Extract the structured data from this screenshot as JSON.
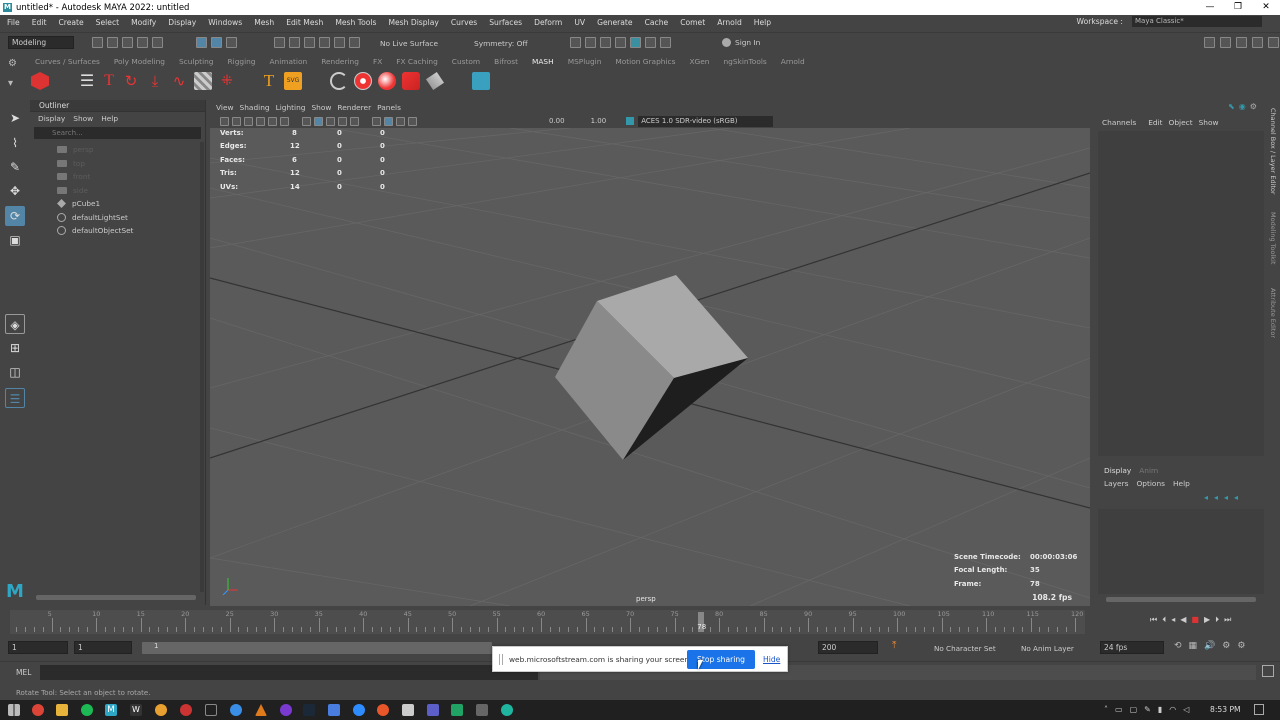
{
  "window": {
    "title": "untitled* - Autodesk MAYA 2022: untitled",
    "minimize": "—",
    "maximize": "❐",
    "close": "✕"
  },
  "menubar": {
    "items": [
      "File",
      "Edit",
      "Create",
      "Select",
      "Modify",
      "Display",
      "Windows",
      "Mesh",
      "Edit Mesh",
      "Mesh Tools",
      "Mesh Display",
      "Curves",
      "Surfaces",
      "Deform",
      "UV",
      "Generate",
      "Cache",
      "Comet",
      "Arnold",
      "Help"
    ]
  },
  "workspace": {
    "label": "Workspace :",
    "value": "Maya Classic*"
  },
  "statusline": {
    "mode": "Modeling",
    "live_surface": "No Live Surface",
    "symmetry": "Symmetry: Off",
    "sign_in": "Sign In"
  },
  "shelf": {
    "tabs": [
      "Curves / Surfaces",
      "Poly Modeling",
      "Sculpting",
      "Rigging",
      "Animation",
      "Rendering",
      "FX",
      "FX Caching",
      "Custom",
      "Bifrost",
      "MASH",
      "MSPlugin",
      "Motion Graphics",
      "XGen",
      "ngSkinTools",
      "Arnold"
    ],
    "active": "MASH"
  },
  "outliner": {
    "title": "Outliner",
    "menu": [
      "Display",
      "Show",
      "Help"
    ],
    "search_placeholder": "Search...",
    "items": [
      {
        "label": "persp",
        "dim": true
      },
      {
        "label": "top",
        "dim": true
      },
      {
        "label": "front",
        "dim": true
      },
      {
        "label": "side",
        "dim": true
      },
      {
        "label": "pCube1",
        "dim": false
      },
      {
        "label": "defaultLightSet",
        "dim": false
      },
      {
        "label": "defaultObjectSet",
        "dim": false
      }
    ]
  },
  "viewport": {
    "menu": [
      "View",
      "Shading",
      "Lighting",
      "Show",
      "Renderer",
      "Panels"
    ],
    "exposure": "0.00",
    "gamma": "1.00",
    "colorspace": "ACES 1.0 SDR-video (sRGB)",
    "camera": "persp",
    "stats": [
      {
        "label": "Verts:",
        "v1": "8",
        "v2": "0",
        "v3": "0"
      },
      {
        "label": "Edges:",
        "v1": "12",
        "v2": "0",
        "v3": "0"
      },
      {
        "label": "Faces:",
        "v1": "6",
        "v2": "0",
        "v3": "0"
      },
      {
        "label": "Tris:",
        "v1": "12",
        "v2": "0",
        "v3": "0"
      },
      {
        "label": "UVs:",
        "v1": "14",
        "v2": "0",
        "v3": "0"
      }
    ],
    "hud": {
      "timecode_label": "Scene Timecode:",
      "timecode": "00:00:03:06",
      "focal_label": "Focal Length:",
      "focal": "35",
      "frame_label": "Frame:",
      "frame": "78",
      "fps": "108.2 fps"
    }
  },
  "channelbox": {
    "menu": [
      "Channels",
      "Edit",
      "Object",
      "Show"
    ]
  },
  "sidetabs": [
    "Channel Box / Layer Editor",
    "Modeling Toolkit",
    "Attribute Editor"
  ],
  "layers": {
    "tabs": [
      "Display",
      "Anim"
    ],
    "active": "Display",
    "menu": [
      "Layers",
      "Options",
      "Help"
    ]
  },
  "timeline": {
    "ticks": [
      "5",
      "10",
      "15",
      "20",
      "25",
      "30",
      "35",
      "40",
      "45",
      "50",
      "55",
      "60",
      "65",
      "70",
      "75",
      "80",
      "85",
      "90",
      "95",
      "100",
      "105",
      "110",
      "115",
      "120"
    ],
    "current": "78"
  },
  "range": {
    "start": "1",
    "inner_start": "1",
    "inner_start_bar": "1",
    "end": "200",
    "character_set": "No Character Set",
    "anim_layer": "No Anim Layer",
    "fps": "24 fps"
  },
  "mel": {
    "label": "MEL"
  },
  "helpline": {
    "text": "Rotate Tool: Select an object to rotate."
  },
  "share": {
    "message": "web.microsoftstream.com is sharing your screen.",
    "stop": "Stop sharing",
    "hide": "Hide"
  },
  "taskbar": {
    "time": "8:53 PM"
  },
  "colors": {
    "accent": "#5285a6",
    "stop_button": "#1a73e8"
  }
}
